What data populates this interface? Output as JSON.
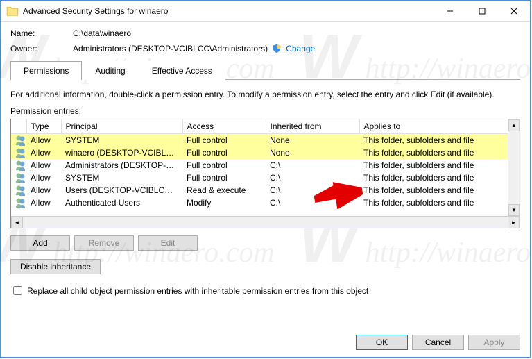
{
  "window": {
    "title": "Advanced Security Settings for winaero"
  },
  "fields": {
    "name_label": "Name:",
    "name_value": "C:\\data\\winaero",
    "owner_label": "Owner:",
    "owner_value": "Administrators (DESKTOP-VCIBLCC\\Administrators)",
    "change_link": "Change"
  },
  "tabs": {
    "permissions": "Permissions",
    "auditing": "Auditing",
    "effective": "Effective Access"
  },
  "info": "For additional information, double-click a permission entry. To modify a permission entry, select the entry and click Edit (if available).",
  "section": "Permission entries:",
  "columns": {
    "type": "Type",
    "principal": "Principal",
    "access": "Access",
    "inherited": "Inherited from",
    "applies": "Applies to"
  },
  "entries": [
    {
      "type": "Allow",
      "principal": "SYSTEM",
      "access": "Full control",
      "inherited": "None",
      "applies": "This folder, subfolders and file",
      "highlight": true
    },
    {
      "type": "Allow",
      "principal": "winaero (DESKTOP-VCIBLCC\\...",
      "access": "Full control",
      "inherited": "None",
      "applies": "This folder, subfolders and file",
      "highlight": true
    },
    {
      "type": "Allow",
      "principal": "Administrators (DESKTOP-VCI...",
      "access": "Full control",
      "inherited": "C:\\",
      "applies": "This folder, subfolders and file",
      "highlight": false
    },
    {
      "type": "Allow",
      "principal": "SYSTEM",
      "access": "Full control",
      "inherited": "C:\\",
      "applies": "This folder, subfolders and file",
      "highlight": false
    },
    {
      "type": "Allow",
      "principal": "Users (DESKTOP-VCIBLCC\\Us...",
      "access": "Read & execute",
      "inherited": "C:\\",
      "applies": "This folder, subfolders and file",
      "highlight": false
    },
    {
      "type": "Allow",
      "principal": "Authenticated Users",
      "access": "Modify",
      "inherited": "C:\\",
      "applies": "This folder, subfolders and file",
      "highlight": false
    }
  ],
  "buttons": {
    "add": "Add",
    "remove": "Remove",
    "edit": "Edit",
    "disable": "Disable inheritance",
    "ok": "OK",
    "cancel": "Cancel",
    "apply": "Apply"
  },
  "checkbox": {
    "label": "Replace all child object permission entries with inheritable permission entries from this object"
  }
}
